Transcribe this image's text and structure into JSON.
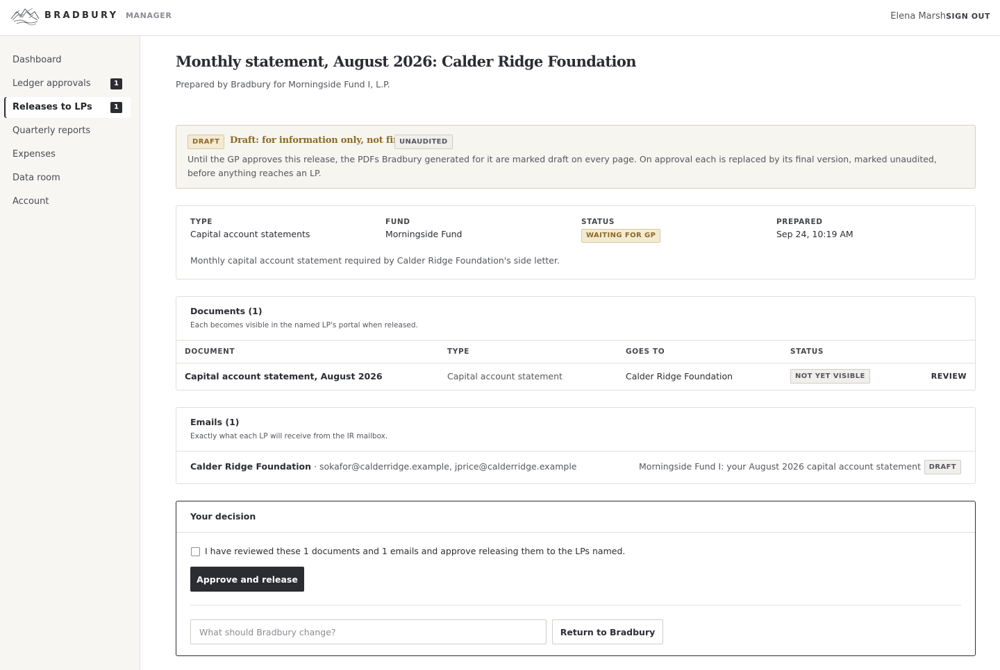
{
  "header": {
    "brand": "BRADBURY",
    "brand_sub": "MANAGER",
    "user_name": "Elena Marsh",
    "sign_out": "SIGN OUT"
  },
  "sidebar": {
    "items": [
      {
        "label": "Dashboard",
        "badge": null,
        "active": false
      },
      {
        "label": "Ledger approvals",
        "badge": "1",
        "active": false
      },
      {
        "label": "Releases to LPs",
        "badge": "1",
        "active": true
      },
      {
        "label": "Quarterly reports",
        "badge": null,
        "active": false
      },
      {
        "label": "Expenses",
        "badge": null,
        "active": false
      },
      {
        "label": "Data room",
        "badge": null,
        "active": false
      },
      {
        "label": "Account",
        "badge": null,
        "active": false
      }
    ]
  },
  "page": {
    "title": "Monthly statement, August 2026: Calder Ridge Foundation",
    "subtitle": "Prepared by Bradbury for Morningside Fund I, L.P."
  },
  "notice": {
    "draft_tag": "DRAFT",
    "heading": "Draft: for information only, not final.",
    "unaudited_tag": "UNAUDITED",
    "body": "Until the GP approves this release, the PDFs Bradbury generated for it are marked draft on every page. On approval each is replaced by its final version, marked unaudited, before anything reaches an LP."
  },
  "summary": {
    "type_label": "TYPE",
    "type_value": "Capital account statements",
    "fund_label": "FUND",
    "fund_value": "Morningside Fund",
    "status_label": "STATUS",
    "status_value": "WAITING FOR GP",
    "prepared_label": "PREPARED",
    "prepared_value": "Sep 24, 10:19 AM",
    "description": "Monthly capital account statement required by Calder Ridge Foundation's side letter."
  },
  "documents": {
    "title": "Documents (1)",
    "subtitle": "Each becomes visible in the named LP's portal when released.",
    "columns": [
      "DOCUMENT",
      "TYPE",
      "GOES TO",
      "STATUS"
    ],
    "rows": [
      {
        "document": "Capital account statement, August 2026",
        "type": "Capital account statement",
        "goes_to": "Calder Ridge Foundation",
        "status": "NOT YET VISIBLE",
        "action": "REVIEW"
      }
    ]
  },
  "emails": {
    "title": "Emails (1)",
    "subtitle": "Exactly what each LP will receive from the IR mailbox.",
    "rows": [
      {
        "recipient": "Calder Ridge Foundation",
        "addresses": " · sokafor@calderridge.example, jprice@calderridge.example",
        "subject": "Morningside Fund I: your August 2026 capital account statement",
        "tag": "DRAFT"
      }
    ]
  },
  "decision": {
    "title": "Your decision",
    "checkbox_label": "I have reviewed these 1 documents and 1 emails and approve releasing them to the LPs named.",
    "approve_button": "Approve and release",
    "change_placeholder": "What should Bradbury change?",
    "return_button": "Return to Bradbury"
  }
}
